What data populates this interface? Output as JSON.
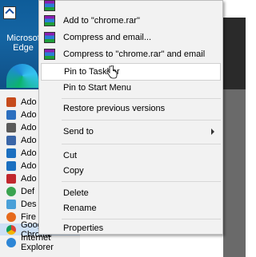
{
  "desktop": {
    "edge_label_line1": "Microsof",
    "edge_label_line2": "Edge"
  },
  "start_list": {
    "items": [
      {
        "label": "Ado",
        "icon": "bridge-icon",
        "color": "#c64b1c"
      },
      {
        "label": "Ado",
        "icon": "lightroom-icon",
        "color": "#2c6fbf"
      },
      {
        "label": "Ado",
        "icon": "gear-icon",
        "color": "#5a5a5a"
      },
      {
        "label": "Ado",
        "icon": "network-icon",
        "color": "#3a66a8"
      },
      {
        "label": "Ado",
        "icon": "photoshop-icon",
        "color": "#1b6fc0"
      },
      {
        "label": "Ado",
        "icon": "photoshop-icon",
        "color": "#1b6fc0"
      },
      {
        "label": "Ado",
        "icon": "acrobat-icon",
        "color": "#c1272d"
      },
      {
        "label": "Def",
        "icon": "default-programs-icon",
        "color": "#3aa34f"
      },
      {
        "label": "Des",
        "icon": "desktop-gadgets-icon",
        "color": "#4aa0d8"
      },
      {
        "label": "Fire",
        "icon": "firefox-icon",
        "color": "#e66a1c"
      },
      {
        "label": "Google Chrome",
        "icon": "chrome-icon",
        "color": "#2e9b3e"
      },
      {
        "label": "Internet Explorer",
        "icon": "ie-icon",
        "color": "#2e86d6"
      }
    ]
  },
  "context_menu": {
    "add_to_archive": "Add to \"chrome.rar\"",
    "compress_email": "Compress and email...",
    "compress_to_rar_email": "Compress to \"chrome.rar\" and email",
    "pin_taskbar": "Pin to Taskbar",
    "pin_start": "Pin to Start Menu",
    "restore_versions": "Restore previous versions",
    "send_to": "Send to",
    "cut": "Cut",
    "copy": "Copy",
    "delete": "Delete",
    "rename": "Rename",
    "properties": "Properties"
  },
  "colors": {
    "menu_bg": "#f2f2f2",
    "highlight": "#ffffff",
    "desktop_blue": "#1565a3"
  }
}
